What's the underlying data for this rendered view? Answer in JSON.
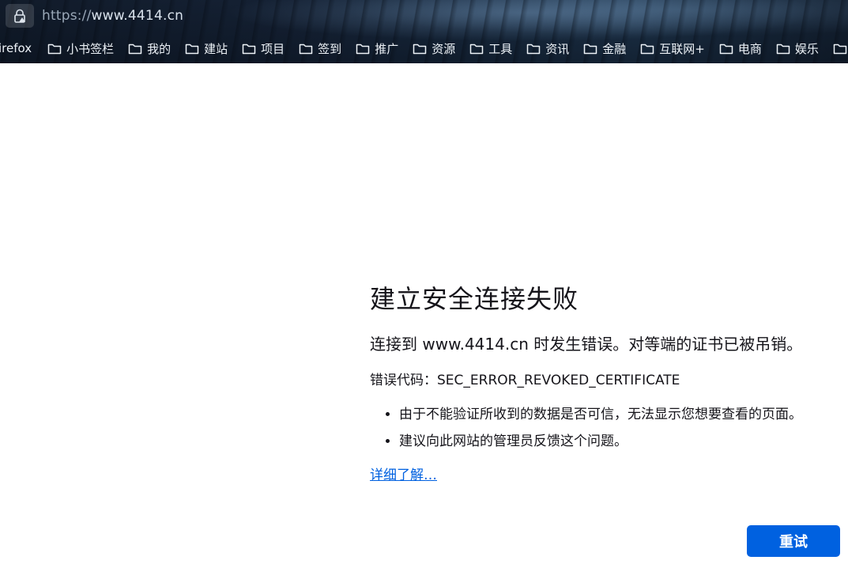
{
  "browser": {
    "url_scheme": "https://",
    "url_host": "www.4414.cn",
    "bookmarks": [
      {
        "label": "irefox",
        "icon": "firefox-bookmark"
      },
      {
        "label": "小书签栏",
        "icon": "folder-icon"
      },
      {
        "label": "我的",
        "icon": "folder-icon"
      },
      {
        "label": "建站",
        "icon": "folder-icon"
      },
      {
        "label": "项目",
        "icon": "folder-icon"
      },
      {
        "label": "签到",
        "icon": "folder-icon"
      },
      {
        "label": "推广",
        "icon": "folder-icon"
      },
      {
        "label": "资源",
        "icon": "folder-icon"
      },
      {
        "label": "工具",
        "icon": "folder-icon"
      },
      {
        "label": "资讯",
        "icon": "folder-icon"
      },
      {
        "label": "金融",
        "icon": "folder-icon"
      },
      {
        "label": "互联网+",
        "icon": "folder-icon"
      },
      {
        "label": "电商",
        "icon": "folder-icon"
      },
      {
        "label": "娱乐",
        "icon": "folder-icon"
      }
    ]
  },
  "error_page": {
    "title": "建立安全连接失败",
    "description": "连接到 www.4414.cn 时发生错误。对等端的证书已被吊销。",
    "error_code_label": "错误代码：",
    "error_code": "SEC_ERROR_REVOKED_CERTIFICATE",
    "bullets": [
      "由于不能验证所收到的数据是否可信，无法显示您想要查看的页面。",
      "建议向此网站的管理员反馈这个问题。"
    ],
    "learn_more": "详细了解…",
    "retry_button": "重试"
  },
  "colors": {
    "accent": "#0061e0",
    "text": "#15141a"
  }
}
